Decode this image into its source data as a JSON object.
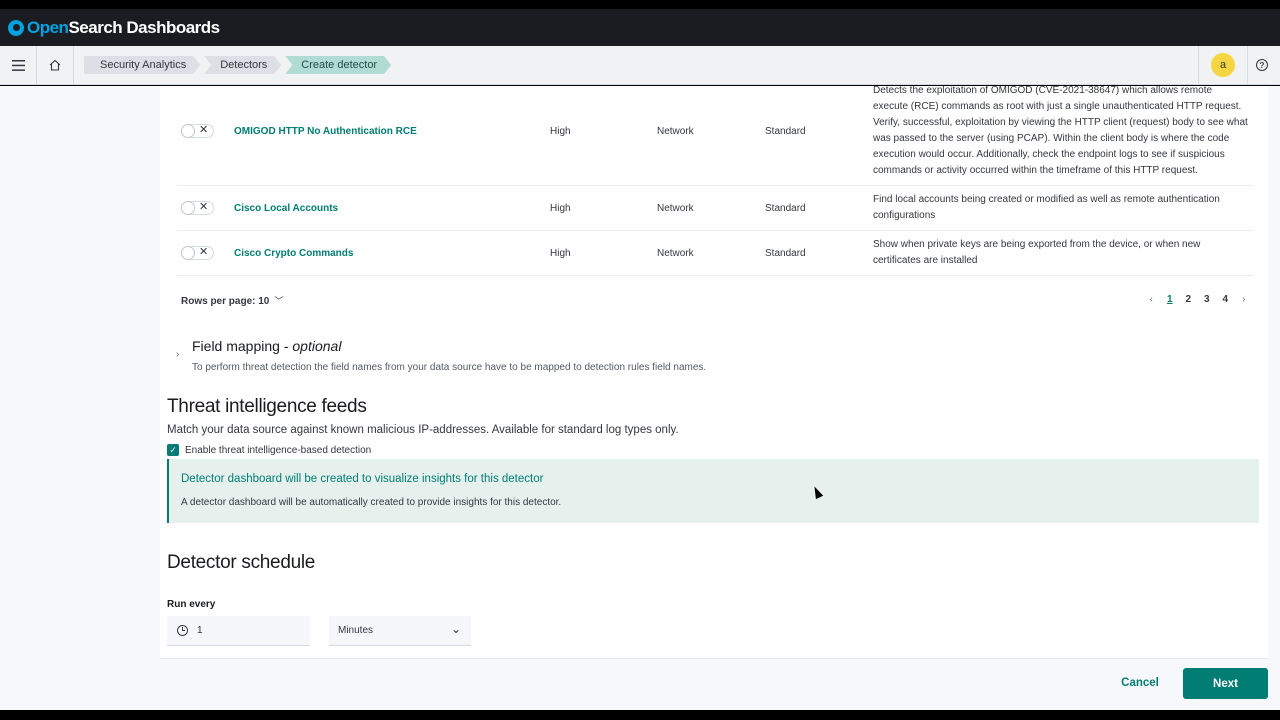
{
  "app": {
    "logo_open": "Open",
    "logo_rest": "Search Dashboards"
  },
  "breadcrumbs": [
    "Security Analytics",
    "Detectors",
    "Create detector"
  ],
  "user": {
    "avatar_initial": "a"
  },
  "rules": [
    {
      "name": "OMIGOD HTTP No Authentication RCE",
      "severity": "High",
      "category": "Network",
      "source": "Standard",
      "description": "Detects the exploitation of OMIGOD (CVE-2021-38647) which allows remote execute (RCE) commands as root with just a single unauthenticated HTTP request. Verify, successful, exploitation by viewing the HTTP client (request) body to see what was passed to the server (using PCAP). Within the client body is where the code execution would occur. Additionally, check the endpoint logs to see if suspicious commands or activity occurred within the timeframe of this HTTP request."
    },
    {
      "name": "Cisco Local Accounts",
      "severity": "High",
      "category": "Network",
      "source": "Standard",
      "description": "Find local accounts being created or modified as well as remote authentication configurations"
    },
    {
      "name": "Cisco Crypto Commands",
      "severity": "High",
      "category": "Network",
      "source": "Standard",
      "description": "Show when private keys are being exported from the device, or when new certificates are installed"
    }
  ],
  "pagination": {
    "rows_per_page_label": "Rows per page: 10",
    "pages": [
      "1",
      "2",
      "3",
      "4"
    ],
    "current_page": "1"
  },
  "field_mapping": {
    "title": "Field mapping - ",
    "title_optional": "optional",
    "subtitle": "To perform threat detection the field names from your data source have to be mapped to detection rules field names."
  },
  "threat_intel": {
    "title": "Threat intelligence feeds",
    "description": "Match your data source against known malicious IP-addresses. Available for standard log types only.",
    "checkbox_label": "Enable threat intelligence-based detection",
    "checkbox_checked": true
  },
  "callout": {
    "title": "Detector dashboard will be created to visualize insights for this detector",
    "text": "A detector dashboard will be automatically created to provide insights for this detector."
  },
  "schedule": {
    "title": "Detector schedule",
    "run_every_label": "Run every",
    "interval_value": "1",
    "unit_value": "Minutes"
  },
  "actions": {
    "cancel_label": "Cancel",
    "next_label": "Next"
  },
  "colors": {
    "accent": "#017d73",
    "callout_bg": "#e6f1ee",
    "header_bg": "#1a1c21"
  }
}
